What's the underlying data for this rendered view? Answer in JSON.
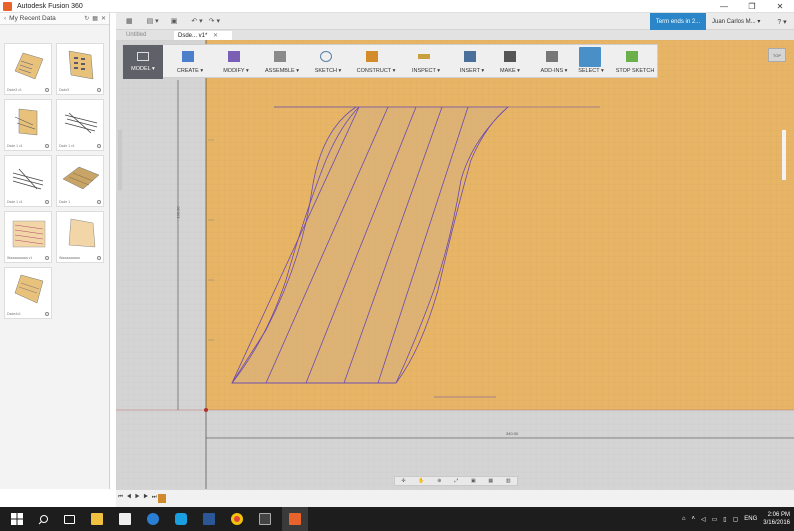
{
  "window": {
    "title": "Autodesk Fusion 360",
    "controls": [
      "—",
      "❐",
      "✕"
    ]
  },
  "data_panel": {
    "header": "My Recent Data",
    "items": [
      {
        "caption": "Dsde3 v1"
      },
      {
        "caption": "Dsde3"
      },
      {
        "caption": "Dsde 1 v1"
      },
      {
        "caption": "Dsde 1 v1"
      },
      {
        "caption": "Dsde 1 v1"
      },
      {
        "caption": "Dsde 1"
      },
      {
        "caption": "Waaaaaaaaa v1"
      },
      {
        "caption": "Waaaaaaaaa"
      },
      {
        "caption": "Dsde4v1"
      }
    ]
  },
  "appbar": {
    "trial": "Term ends in 2...",
    "user": "Juan Carlos M... ▾",
    "help": "? ▾"
  },
  "tabs": [
    {
      "label": "Untitled"
    },
    {
      "label": "Dsde... v1*"
    }
  ],
  "toolbar": {
    "model": "MODEL ▾",
    "groups": [
      {
        "label": "CREATE ▾",
        "icon": "cube-icon",
        "color": "#4b7fc9"
      },
      {
        "label": "MODIFY ▾",
        "icon": "modify-icon",
        "color": "#7b5fb5"
      },
      {
        "label": "ASSEMBLE ▾",
        "icon": "assemble-icon",
        "color": "#6a6a6a"
      },
      {
        "label": "SKETCH ▾",
        "icon": "sketch-icon",
        "color": "#5b7fa8"
      },
      {
        "label": "CONSTRUCT ▾",
        "icon": "construct-icon",
        "color": "#d48b2a"
      },
      {
        "label": "INSPECT ▾",
        "icon": "inspect-icon",
        "color": "#c8a040"
      },
      {
        "label": "INSERT ▾",
        "icon": "insert-icon",
        "color": "#4a6f9a"
      },
      {
        "label": "MAKE ▾",
        "icon": "make-icon",
        "color": "#555555"
      },
      {
        "label": "ADD-INS ▾",
        "icon": "addins-icon",
        "color": "#666666"
      },
      {
        "label": "SELECT ▾",
        "icon": "select-icon",
        "color": "#4a90c8",
        "selected": true
      },
      {
        "label": "STOP SKETCH",
        "icon": "stop-sketch-icon",
        "color": "#6bb04a"
      }
    ]
  },
  "viewcube": "TOP",
  "dimensions": {
    "vertical": "100.00",
    "horizontal": "340.00"
  },
  "taskbar": {
    "language": "ENG",
    "time": "2:06 PM",
    "date": "3/16/2016",
    "icons": [
      "windows-icon",
      "search-icon",
      "task-view-icon",
      "file-explorer-icon",
      "store-icon",
      "edge-icon",
      "skype-icon",
      "word-icon",
      "chrome-icon",
      "fusion-app-icon",
      "fusion360-icon"
    ]
  },
  "colors": {
    "canvas": "#e7b565",
    "sketch_line": "#6a4bb0",
    "accent": "#2a86c8"
  }
}
